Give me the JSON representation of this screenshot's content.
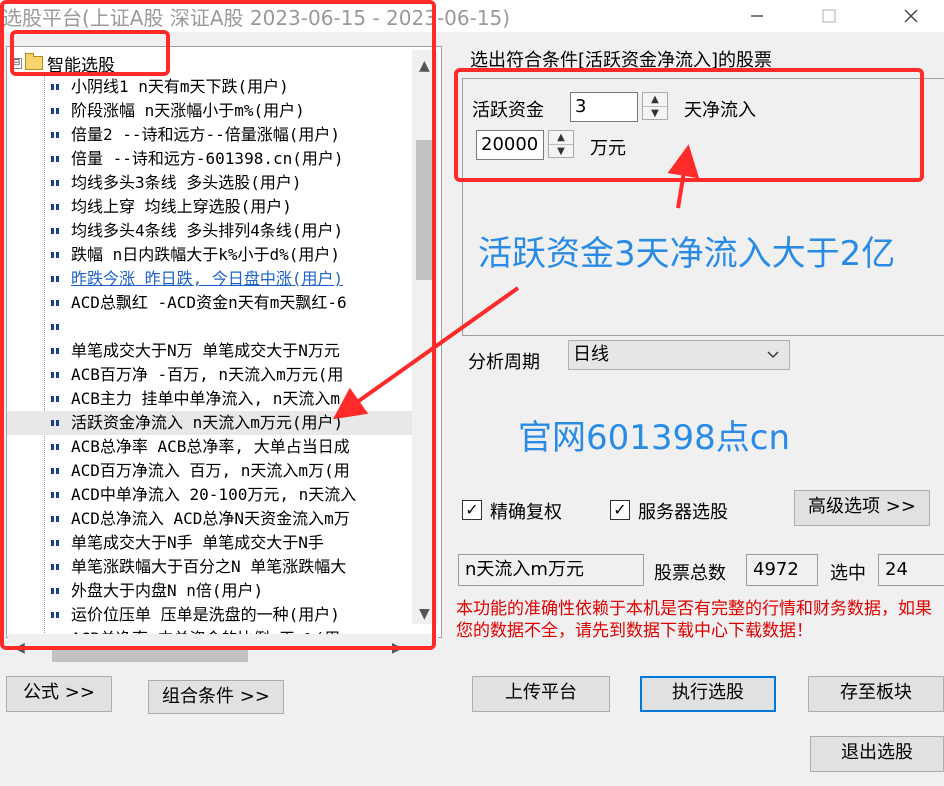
{
  "window": {
    "title": "选股平台(上证A股 深证A股   2023-06-15 - 2023-06-15)",
    "minimize_icon": "minimize-icon",
    "maximize_icon": "maximize-icon",
    "close_icon": "close-icon"
  },
  "tree": {
    "root_label": "智能选股",
    "expander": "⊟",
    "items": [
      {
        "label": "小阴线1 n天有m天下跌(用户)"
      },
      {
        "label": "阶段涨幅 n天涨幅小于m%(用户)"
      },
      {
        "label": "倍量2 --诗和远方--倍量涨幅(用户)"
      },
      {
        "label": "倍量 --诗和远方-601398.cn(用户)"
      },
      {
        "label": "均线多头3条线 多头选股(用户)"
      },
      {
        "label": "均线上穿 均线上穿选股(用户)"
      },
      {
        "label": "均线多头4条线 多头排列4条线(用户)"
      },
      {
        "label": "跌幅 n日内跌幅大于k%小于d%(用户)"
      },
      {
        "label": "昨跌今涨 昨日跌, 今日盘中涨(用户)",
        "link": true
      },
      {
        "label": "ACD总飘红 -ACD资金n天有m天飘红-6"
      },
      {
        "label": ""
      },
      {
        "label": "单笔成交大于N万 单笔成交大于N万元"
      },
      {
        "label": "ACB百万净 -百万, n天流入m万元(用"
      },
      {
        "label": "ACB主力 挂单中单净流入, n天流入m"
      },
      {
        "label": "活跃资金净流入 n天流入m万元(用户)",
        "highlight": true
      },
      {
        "label": "ACB总净率 ACB总净率, 大单占当日成"
      },
      {
        "label": "ACD百万净流入 百万, n天流入m万(用"
      },
      {
        "label": "ACD中单净流入 20-100万元, n天流入"
      },
      {
        "label": "ACD总净流入 ACD总净N天资金流入m万"
      },
      {
        "label": "单笔成交大于N手  单笔成交大于N手"
      },
      {
        "label": "单笔涨跌幅大于百分之N 单笔涨跌幅大"
      },
      {
        "label": "外盘大于内盘N n倍(用户)"
      },
      {
        "label": "运价位压单 压单是洗盘的一种(用户)"
      },
      {
        "label": "ACB单净率 中单资金的比例 天m%(用"
      }
    ]
  },
  "scroll": {
    "up_arrow": "▲",
    "down_arrow": "▼",
    "left_arrow": "◀",
    "right_arrow": "▶"
  },
  "params": {
    "heading": "选出符合条件[活跃资金净流入]的股票",
    "label1": "活跃资金",
    "value1": "3",
    "suffix1": "天净流入",
    "value2": "20000",
    "suffix2": "万元"
  },
  "period": {
    "label": "分析周期",
    "selected": "日线"
  },
  "options": {
    "exact_rights": "精确复权",
    "server_pick": "服务器选股",
    "advanced_button": "高级选项 >>",
    "check_mark": "✓"
  },
  "stats": {
    "desc": "n天流入m万元",
    "total_label": "股票总数",
    "total_value": "4972",
    "selected_label": "选中",
    "selected_value": "24"
  },
  "warning": "本功能的准确性依赖于本机是否有完整的行情和财务数据，如果您的数据不全，请先到数据下载中心下载数据！",
  "buttons": {
    "formula": "公式 >>",
    "combo": "组合条件 >>",
    "upload": "上传平台",
    "execute": "执行选股",
    "save_block": "存至板块",
    "exit": "退出选股"
  },
  "annotations": {
    "note_rule": "活跃资金3天净流入大于2亿",
    "note_site": "官网601398点cn",
    "colors": {
      "frame": "#ff2a2a",
      "note": "#2a8be6"
    }
  }
}
